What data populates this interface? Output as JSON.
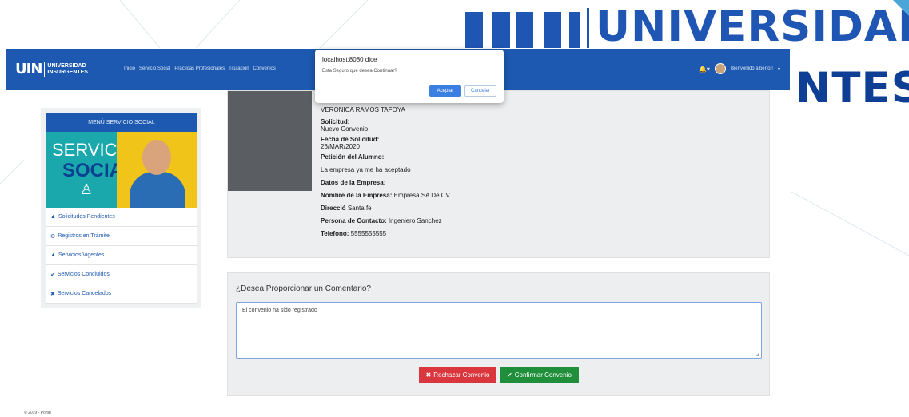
{
  "watermark": {
    "top_text": "UNIVERSIDAD",
    "bottom_text": "NTES"
  },
  "navbar": {
    "brand_mark": "UIN",
    "brand_line1": "UNIVERSIDAD",
    "brand_line2": "INSURGENTES",
    "links": [
      "Inicio",
      "Servicio Social",
      "Prácticas Profesionales",
      "Titulación",
      "Convenios"
    ],
    "user_greeting": "Bienvenido alberto !",
    "accent": "#1d59b0"
  },
  "dialog": {
    "title": "localhost:8080 dice",
    "message": "Esta Seguro que desea Continuar?",
    "ok_label": "Aceptar",
    "cancel_label": "Cancelar"
  },
  "sidebar": {
    "header": "MENÚ SERVICIO SOCIAL",
    "banner_word1": "SERVICIO",
    "banner_word2": "SOCIAL",
    "items": [
      {
        "label": "Solicitudes Pendientes",
        "icon": "warning-icon"
      },
      {
        "label": "Registros en Trámite",
        "icon": "cogs-icon"
      },
      {
        "label": "Servicios Vigentes",
        "icon": "graduation-cap-icon"
      },
      {
        "label": "Servicios Concluidos",
        "icon": "check-icon"
      },
      {
        "label": "Servicios Cancelados",
        "icon": "times-icon"
      }
    ]
  },
  "detail": {
    "student_name": "VERONICA RAMOS TAFOYA",
    "solicitud_label": "Solicitud:",
    "solicitud_value": "Nuevo Convenio",
    "fecha_label": "Fecha de Solicitud:",
    "fecha_value": "26/MAR/2020",
    "peticion_label": "Petición del Alumno:",
    "peticion_value": "La empresa ya me ha aceptado",
    "datos_label": "Datos de la Empresa:",
    "empresa_label": "Nombre de la Empresa:",
    "empresa_value": "Empresa SA De CV",
    "direccion_label": "Direcció",
    "direccion_value": "Santa fe",
    "contacto_label": "Persona de Contacto:",
    "contacto_value": "Ingeniero Sanchez",
    "telefono_label": "Telefono:",
    "telefono_value": "5555555555"
  },
  "comment": {
    "title": "¿Desea Proporcionar un Comentario?",
    "value": "El convenio ha sido registrado",
    "reject_label": "Rechazar Convenio",
    "confirm_label": "Confirmar Convenio"
  },
  "footer": {
    "text": "© 2019 - Portal"
  }
}
